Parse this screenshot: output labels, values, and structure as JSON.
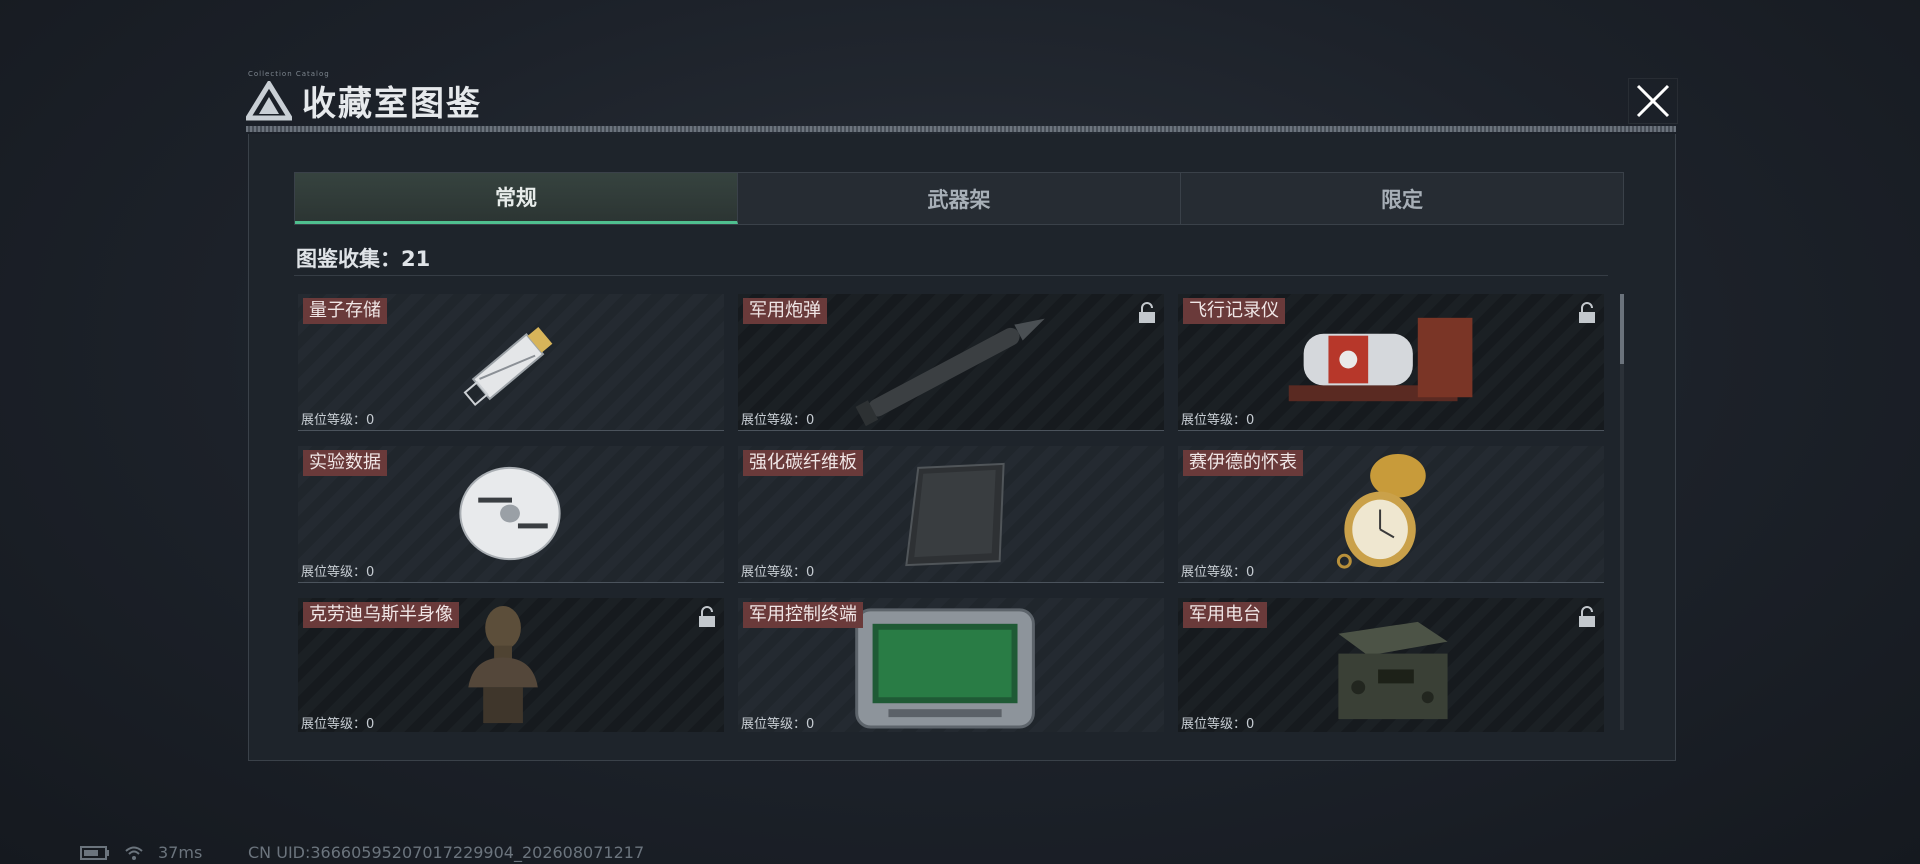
{
  "header": {
    "title": "收藏室图鉴",
    "tiny_text": "Collection Catalog",
    "close_icon": "close-icon"
  },
  "tabs": [
    {
      "label": "常规",
      "active": true
    },
    {
      "label": "武器架",
      "active": false
    },
    {
      "label": "限定",
      "active": false
    }
  ],
  "collection": {
    "label": "图鉴收集：21"
  },
  "level_prefix": "展位等级：",
  "items": [
    {
      "name": "量子存储",
      "level": "展位等级：0",
      "locked": false,
      "art": "usb-drive"
    },
    {
      "name": "军用炮弹",
      "level": "展位等级：0",
      "locked": true,
      "art": "shell"
    },
    {
      "name": "飞行记录仪",
      "level": "展位等级：0",
      "locked": true,
      "art": "flight-recorder"
    },
    {
      "name": "实验数据",
      "level": "展位等级：0",
      "locked": false,
      "art": "disc"
    },
    {
      "name": "强化碳纤维板",
      "level": "展位等级：0",
      "locked": false,
      "art": "carbon-plate"
    },
    {
      "name": "赛伊德的怀表",
      "level": "展位等级：0",
      "locked": false,
      "art": "pocket-watch"
    },
    {
      "name": "克劳迪乌斯半身像",
      "level": "展位等级：0",
      "locked": true,
      "art": "bust"
    },
    {
      "name": "军用控制终端",
      "level": "展位等级：0",
      "locked": false,
      "art": "terminal"
    },
    {
      "name": "军用电台",
      "level": "展位等级：0",
      "locked": true,
      "art": "radio"
    }
  ],
  "status": {
    "ping": "37ms",
    "uid": "CN UID:36660595207017229904_202608071217"
  },
  "colors": {
    "accent": "#4fbf8f",
    "name_tag": "#6a3a3a"
  }
}
